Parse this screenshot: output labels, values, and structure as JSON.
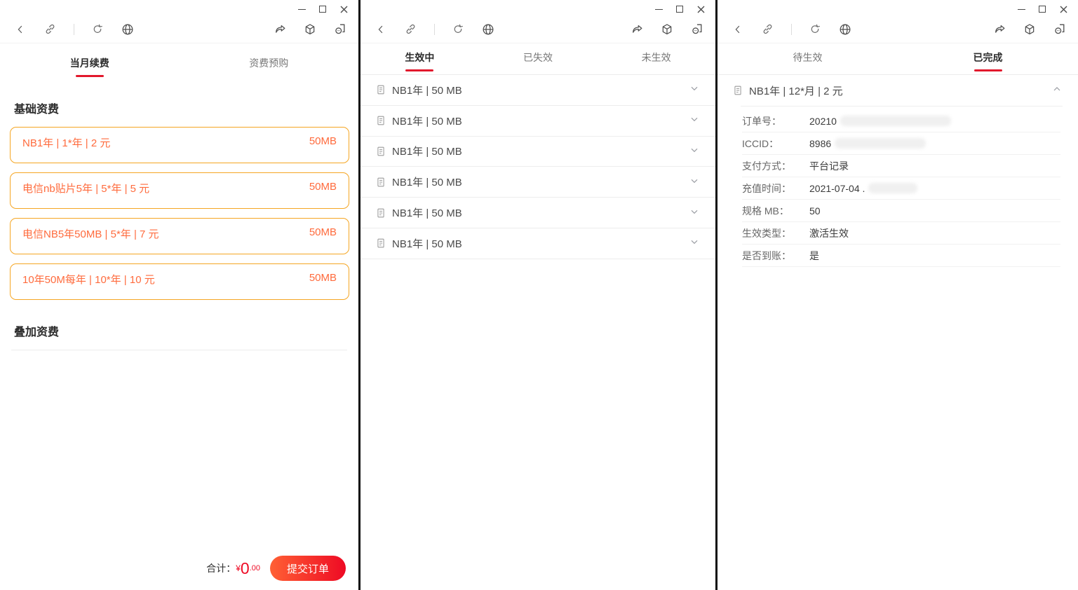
{
  "theme": {
    "accent_red": "#e2182c",
    "price_red": "#ee0a24",
    "btn_grad_start": "#ff6034",
    "btn_grad_end": "#ee0a24",
    "card_border": "#f5a623",
    "card_text": "#ff6b3d"
  },
  "icons": {
    "toolbar_left": [
      "back-icon",
      "link-icon",
      "refresh-icon",
      "globe-icon"
    ],
    "toolbar_right": [
      "share-icon",
      "cube-icon",
      "session-panel-icon"
    ],
    "window_controls": [
      "minimize-icon",
      "maximize-icon",
      "close-icon"
    ],
    "list_row": [
      "document-icon",
      "chevron-down-icon"
    ],
    "order_header": [
      "document-icon",
      "chevron-up-icon"
    ]
  },
  "windows": [
    {
      "tabs": [
        {
          "label": "当月续费",
          "active": true
        },
        {
          "label": "资费预购",
          "active": false
        }
      ],
      "sections": [
        {
          "title": "基础资费",
          "cards": [
            {
              "name": "NB1年 | 1*年 | 2 元",
              "spec": "50MB"
            },
            {
              "name": "电信nb贴片5年 | 5*年 | 5 元",
              "spec": "50MB"
            },
            {
              "name": "电信NB5年50MB | 5*年 | 7 元",
              "spec": "50MB"
            },
            {
              "name": "10年50M每年 | 10*年 | 10 元",
              "spec": "50MB"
            }
          ]
        },
        {
          "title": "叠加资费",
          "cards": []
        }
      ],
      "footer": {
        "total_label": "合计：",
        "currency": "¥",
        "amount_main": "0",
        "amount_fraction": ".00",
        "submit": "提交订单"
      }
    },
    {
      "tabs": [
        {
          "label": "生效中",
          "active": true
        },
        {
          "label": "已失效",
          "active": false
        },
        {
          "label": "未生效",
          "active": false
        }
      ],
      "rows": [
        {
          "title": "NB1年 | 50 MB"
        },
        {
          "title": "NB1年 | 50 MB"
        },
        {
          "title": "NB1年 | 50 MB"
        },
        {
          "title": "NB1年 | 50 MB"
        },
        {
          "title": "NB1年 | 50 MB"
        },
        {
          "title": "NB1年 | 50 MB"
        }
      ]
    },
    {
      "tabs": [
        {
          "label": "待生效",
          "active": false
        },
        {
          "label": "已完成",
          "active": true
        }
      ],
      "order": {
        "header": "NB1年 | 12*月 | 2 元",
        "fields": [
          {
            "label": "订单号：",
            "value": "20210",
            "redacted": true
          },
          {
            "label": "ICCID：",
            "value": "8986",
            "redacted": true
          },
          {
            "label": "支付方式：",
            "value": "平台记录",
            "redacted": false
          },
          {
            "label": "充值时间：",
            "value": "2021-07-04 .",
            "redacted": true
          },
          {
            "label": "规格 MB：",
            "value": "50",
            "redacted": false
          },
          {
            "label": "生效类型：",
            "value": "激活生效",
            "redacted": false
          },
          {
            "label": "是否到账：",
            "value": "是",
            "redacted": false
          }
        ]
      }
    }
  ]
}
